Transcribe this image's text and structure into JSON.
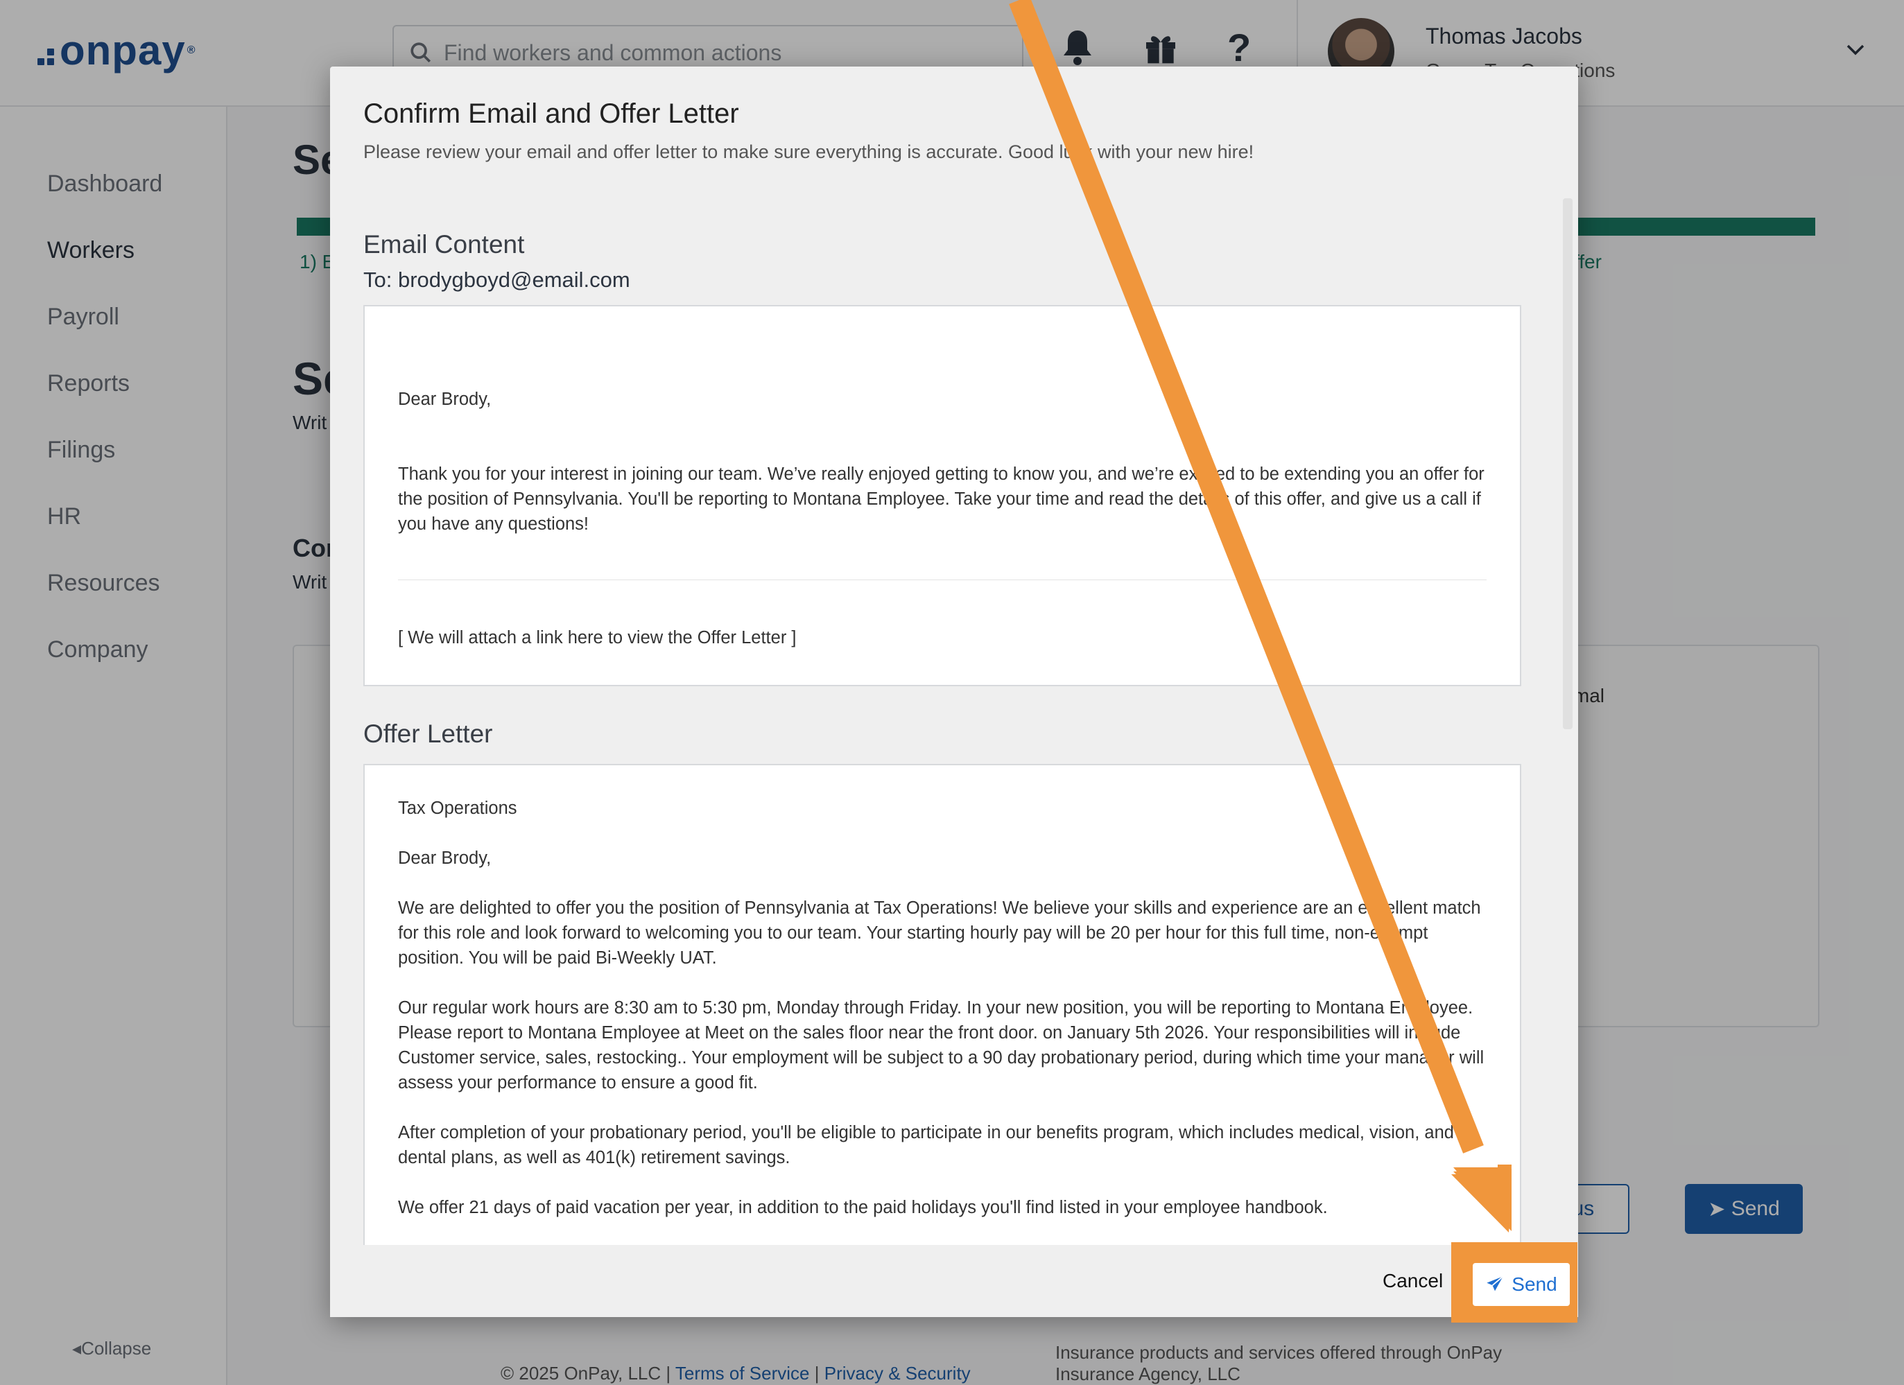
{
  "app": {
    "logo": "onpay",
    "search_placeholder": "Find workers and common actions",
    "user_name": "Thomas Jacobs",
    "user_org": "Green Tax Operations"
  },
  "sidebar": {
    "items": [
      {
        "label": "Dashboard"
      },
      {
        "label": "Workers"
      },
      {
        "label": "Payroll"
      },
      {
        "label": "Reports"
      },
      {
        "label": "Filings"
      },
      {
        "label": "HR"
      },
      {
        "label": "Resources"
      },
      {
        "label": "Company"
      }
    ],
    "collapse_label": "Collapse"
  },
  "background": {
    "heading_1": "Se",
    "step_1": "1) E",
    "step_last": "ffer",
    "heading_2": "Se",
    "sub_2": "Writ",
    "heading_3": "Con",
    "sub_3": "Writ",
    "format_label": "ormal",
    "prev_label": "ous",
    "send_label": "Send"
  },
  "footer": {
    "copyright": "© 2025 OnPay, LLC |",
    "terms": "Terms of Service",
    "separator": "|",
    "privacy": "Privacy & Security",
    "insurance": "Insurance products and services offered through OnPay Insurance Agency, LLC"
  },
  "modal": {
    "title": "Confirm Email and Offer Letter",
    "subtitle": "Please review your email and offer letter to make sure everything is accurate. Good luck with your new hire!",
    "email_section_title": "Email Content",
    "to_label": "To:",
    "to_address": "brodygboyd@email.com",
    "email": {
      "greeting": "Dear Brody,",
      "body": "Thank you for your interest in joining our team. We’ve really enjoyed getting to know you, and we’re excited to be extending you an offer for the position of Pennsylvania. You'll be reporting to Montana Employee. Take your time and read the details of this offer, and give us a call if you have any questions!",
      "attachment_note": "[ We will attach a link here to view the Offer Letter ]"
    },
    "offer_section_title": "Offer Letter",
    "offer": {
      "company": "Tax Operations",
      "greeting": "Dear Brody,",
      "p1": "We are delighted to offer you the position of Pennsylvania at Tax Operations! We believe your skills and experience are an excellent match for this role and look forward to welcoming you to our team. Your starting hourly pay will be 20 per hour for this full time, non-exempt position. You will be paid Bi-Weekly UAT.",
      "p2": "Our regular work hours are 8:30 am to 5:30 pm, Monday through Friday. In your new position, you will be reporting to Montana Employee. Please report to Montana Employee at Meet on the sales floor near the front door. on January 5th 2026. Your responsibilities will include Customer service, sales, restocking.. Your employment will be subject to a 90 day probationary period, during which time your manager will assess your performance to ensure a good fit.",
      "p3": "After completion of your probationary period, you'll be eligible to participate in our benefits program, which includes medical, vision, and dental plans, as well as 401(k) retirement savings.",
      "p4": "We offer 21 days of paid vacation per year, in addition to the paid holidays you'll find listed in your employee handbook."
    },
    "cancel_label": "Cancel",
    "send_label": "Send"
  },
  "annotation": {
    "arrow_color": "#f0963c",
    "highlight_color": "#f0963c"
  }
}
